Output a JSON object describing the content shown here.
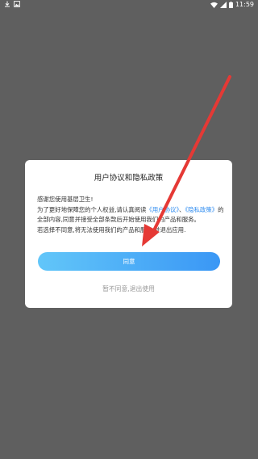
{
  "status_bar": {
    "time": "11:59",
    "icons": [
      "download-icon",
      "image-icon",
      "wifi-icon",
      "signal-icon",
      "battery-icon"
    ]
  },
  "dialog": {
    "title": "用户协议和隐私政策",
    "body": {
      "p1": "感谢您使用基层卫生!",
      "p2_pre": "为了更好地保障您的个人权益,请认真阅读",
      "link_user": "《用户协议》",
      "sep": "、",
      "link_privacy": "《隐私政策》",
      "p2_post": "的全部内容,同意并接受全部条款后开始使用我们的产品和服务。",
      "p3": "若选择不同意,将无法使用我们的产品和服务,并退出应用."
    },
    "agree_label": "同意",
    "disagree_label": "暂不同意,退出使用"
  },
  "colors": {
    "overlay": "#5f5f5f",
    "link": "#2f8cf0",
    "button_start": "#62c6f9",
    "button_end": "#3a97f5",
    "annotation_arrow": "#e53935"
  }
}
